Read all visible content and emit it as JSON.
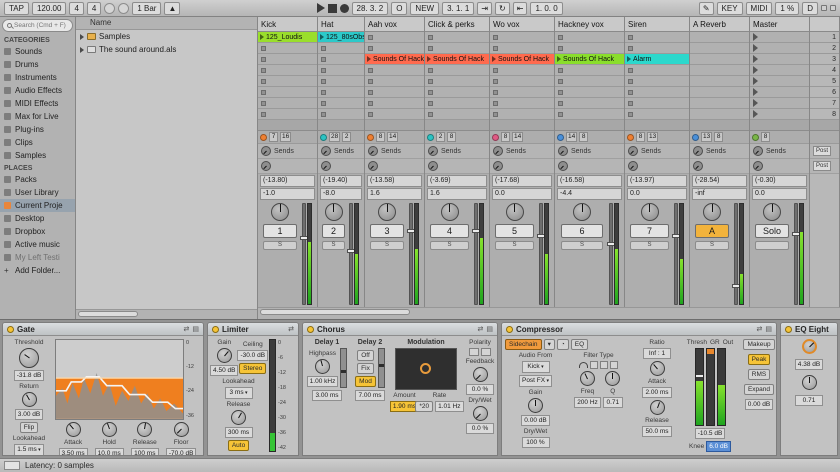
{
  "transport": {
    "tap": "TAP",
    "tempo": "120.00",
    "sig_num": "4",
    "sig_den": "4",
    "quantize": "1 Bar",
    "position": "28. 3. 2",
    "overdub": "O",
    "new_label": "NEW",
    "loop_start": "3. 1. 1",
    "loop_length": "1. 0. 0",
    "key_label": "KEY",
    "midi_label": "MIDI",
    "cpu": "1 %",
    "disk": "D"
  },
  "icons": {
    "metronome": "▲",
    "punch_in": "⇥",
    "loop": "↻",
    "punch_out": "⇤",
    "pencil": "✎"
  },
  "browser": {
    "search_placeholder": "Search (Cmd + F)",
    "categories_title": "CATEGORIES",
    "categories": [
      {
        "label": "Sounds"
      },
      {
        "label": "Drums"
      },
      {
        "label": "Instruments"
      },
      {
        "label": "Audio Effects"
      },
      {
        "label": "MIDI Effects"
      },
      {
        "label": "Max for Live"
      },
      {
        "label": "Plug-ins"
      },
      {
        "label": "Clips"
      },
      {
        "label": "Samples"
      }
    ],
    "places_title": "PLACES",
    "places": [
      {
        "label": "Packs"
      },
      {
        "label": "User Library"
      },
      {
        "label": "Current Proje",
        "selected": true
      },
      {
        "label": "Desktop"
      },
      {
        "label": "Dropbox"
      },
      {
        "label": "Active music"
      },
      {
        "label": "My Left Testi",
        "dim": true
      },
      {
        "label": "Add Folder...",
        "add": true
      }
    ],
    "content_header": "Name",
    "items": [
      {
        "label": "Samples",
        "type": "folder"
      },
      {
        "label": "The sound around.als",
        "type": "file"
      }
    ]
  },
  "session": {
    "sends_label": "Sends",
    "post_label": "Post",
    "solo_label": "Solo",
    "scenes": [
      "1",
      "2",
      "3",
      "4",
      "5",
      "6",
      "7",
      "8"
    ],
    "tracks": [
      {
        "name": "Kick",
        "width": 60,
        "number": "1",
        "peak": "(-13.80)",
        "volume": "-1.0",
        "io": [
          "7",
          "16"
        ],
        "dot": "#ef8032",
        "meter": 0.62,
        "fader": 0.68,
        "clips": [
          {
            "row": 0,
            "label": "125_Loudis",
            "color": "#9ade2c"
          }
        ]
      },
      {
        "name": "Hat",
        "width": 47,
        "number": "2",
        "peak": "(-19.40)",
        "volume": "-8.0",
        "io": [
          "28",
          "2"
        ],
        "dot": "#2cc3c3",
        "meter": 0.5,
        "fader": 0.55,
        "clips": [
          {
            "row": 0,
            "label": "125_80sObs",
            "color": "#2cc9c9"
          }
        ]
      },
      {
        "name": "Aah vox",
        "width": 60,
        "number": "3",
        "peak": "(-13.58)",
        "volume": "1.6",
        "io": [
          "8",
          "14"
        ],
        "dot": "#ef8032",
        "meter": 0.55,
        "fader": 0.75,
        "clips": [
          {
            "row": 2,
            "label": "Sounds Of Hack",
            "color": "#ff6a4e"
          }
        ]
      },
      {
        "name": "Click & perks",
        "width": 65,
        "number": "4",
        "peak": "(-3.69)",
        "volume": "1.6",
        "io": [
          "2",
          "8"
        ],
        "dot": "#2cc3c3",
        "meter": 0.66,
        "fader": 0.75,
        "clips": [
          {
            "row": 2,
            "label": "Sounds Of Hack",
            "color": "#ff6a4e"
          }
        ]
      },
      {
        "name": "Wo vox",
        "width": 65,
        "number": "5",
        "peak": "(-17.68)",
        "volume": "0.0",
        "io": [
          "8",
          "14"
        ],
        "dot": "#e05a84",
        "meter": 0.5,
        "fader": 0.7,
        "clips": [
          {
            "row": 2,
            "label": "Sounds Of Hack",
            "color": "#ff6a4e"
          }
        ]
      },
      {
        "name": "Hackney vox",
        "width": 70,
        "number": "6",
        "peak": "(-16.58)",
        "volume": "-4.4",
        "io": [
          "14",
          "8"
        ],
        "dot": "#4a90d9",
        "meter": 0.55,
        "fader": 0.62,
        "clips": [
          {
            "row": 2,
            "label": "Sounds Of Hack",
            "color": "#8ade2c"
          }
        ]
      },
      {
        "name": "Siren",
        "width": 65,
        "number": "7",
        "peak": "(-13.97)",
        "volume": "0.0",
        "io": [
          "8",
          "13"
        ],
        "dot": "#ef8032",
        "meter": 0.45,
        "fader": 0.7,
        "clips": [
          {
            "row": 2,
            "label": "Alarm",
            "color": "#2cd8cc"
          }
        ]
      },
      {
        "name": "A Reverb",
        "width": 60,
        "number": "A",
        "return": true,
        "peak": "(-28.54)",
        "volume": "-inf",
        "io": [
          "13",
          "8"
        ],
        "dot": "#4a90d9",
        "meter": 0.3,
        "fader": 0.2,
        "clips": []
      },
      {
        "name": "Master",
        "width": 60,
        "master": true,
        "peak": "(-0.30)",
        "volume": "0.0",
        "io": [
          "8"
        ],
        "dot": "#7ab648",
        "meter": 0.72,
        "fader": 0.72,
        "clips": []
      }
    ]
  },
  "devices": {
    "gate": {
      "title": "Gate",
      "threshold_label": "Threshold",
      "threshold": "-31.8 dB",
      "return_label": "Return",
      "return_value": "3.00 dB",
      "flip_label": "Flip",
      "lookahead_label": "Lookahead",
      "lookahead": "1.5 ms",
      "attack_label": "Attack",
      "attack": "3.50 ms",
      "hold_label": "Hold",
      "hold": "10.0 ms",
      "release_label": "Release",
      "release": "100 ms",
      "floor_label": "Floor",
      "floor": "-70.0 dB",
      "scale": [
        "0",
        "-12",
        "-24",
        "-36"
      ]
    },
    "limiter": {
      "title": "Limiter",
      "gain_label": "Gain",
      "gain": "4.50 dB",
      "ceiling_label": "Ceiling",
      "ceiling": "-30.0 dB",
      "stereo_label": "Stereo",
      "lookahead_label": "Lookahead",
      "lookahead": "3 ms",
      "release_label": "Release",
      "release": "300 ms",
      "auto_label": "Auto",
      "scale": [
        "0",
        "-6",
        "-12",
        "-18",
        "-24",
        "-30",
        "-36",
        "-42"
      ]
    },
    "chorus": {
      "title": "Chorus",
      "delay1_label": "Delay 1",
      "highpass_label": "Highpass",
      "highpass": "1.00 kHz",
      "delay1_time": "3.00 ms",
      "delay2_label": "Delay 2",
      "mode_off": "Off",
      "mode_fix": "Fix",
      "mode_mod": "Mod",
      "delay2_time": "7.00 ms",
      "modulation_label": "Modulation",
      "amount_label": "Amount",
      "amount": "1.90 ms",
      "rate_label": "Rate",
      "rate": "1.01 Hz",
      "x20_label": "*20",
      "polarity_label": "Polarity",
      "feedback_label": "Feedback",
      "feedback": "0.0 %",
      "drywet_label": "Dry/Wet",
      "drywet": "0.0 %"
    },
    "compressor": {
      "title": "Compressor",
      "sidechain_label": "Sidechain",
      "eq_label": "EQ",
      "audio_from_label": "Audio From",
      "audio_from": "Kick",
      "audio_from_tap": "Post FX",
      "filter_type_label": "Filter Type",
      "gain_label": "Gain",
      "gain": "0.00 dB",
      "drywet_label": "Dry/Wet",
      "drywet": "100 %",
      "freq_label": "Freq",
      "freq": "200 Hz",
      "q_label": "Q",
      "q": "0.71",
      "ratio_label": "Ratio",
      "ratio": "Inf : 1",
      "attack_label": "Attack",
      "attack": "2.00 ms",
      "release_label": "Release",
      "release": "50.0 ms",
      "thresh_label": "Thresh",
      "gr_label": "GR",
      "out_label": "Out",
      "threshold": "-10.5 dB",
      "knee_label": "Knee",
      "knee": "6.0 dB",
      "out_value": "0.00 dB",
      "makeup_label": "Makeup",
      "peak_label": "Peak",
      "rms_label": "RMS",
      "expand_label": "Expand"
    },
    "eq8": {
      "title": "EQ Eight",
      "gain": "4.38 dB",
      "q": "0.71"
    }
  },
  "status": {
    "latency": "Latency: 0 samples"
  }
}
